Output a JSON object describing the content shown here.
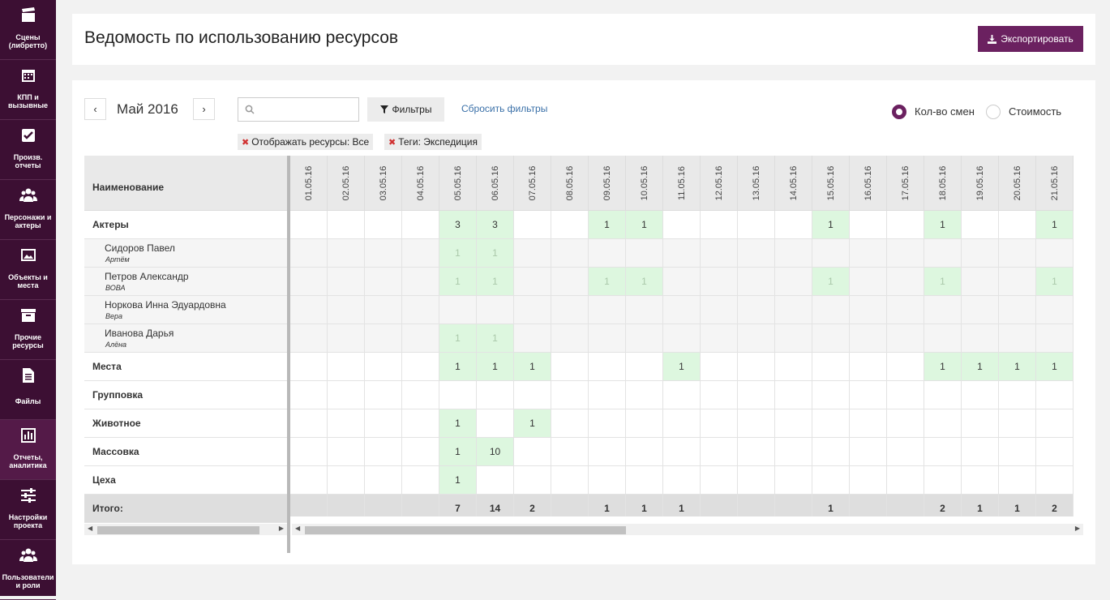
{
  "sidebar": {
    "items": [
      {
        "label": "Сцены (либретто)",
        "icon": "clapperboard-icon"
      },
      {
        "label": "КПП и вызывные",
        "icon": "calendar-icon"
      },
      {
        "label": "Произв. отчеты",
        "icon": "checkbox-icon"
      },
      {
        "label": "Персонажи и актеры",
        "icon": "people-icon"
      },
      {
        "label": "Объекты и места",
        "icon": "image-icon"
      },
      {
        "label": "Прочие ресурсы",
        "icon": "archive-icon"
      },
      {
        "label": "Файлы",
        "icon": "file-icon"
      },
      {
        "label": "Отчеты, аналитика",
        "icon": "bar-chart-icon"
      },
      {
        "label": "Настройки проекта",
        "icon": "sliders-icon"
      },
      {
        "label": "Пользователи и роли",
        "icon": "users-icon"
      }
    ]
  },
  "header": {
    "title": "Ведомость по использованию ресурсов",
    "export_label": "Экспортировать"
  },
  "toolbar": {
    "prev": "‹",
    "next": "›",
    "month": "Май 2016",
    "search_placeholder": "",
    "filters_label": "Фильтры",
    "reset_label": "Сбросить фильтры",
    "tags": [
      "Отображать ресурсы: Все",
      "Теги: Экспедиция"
    ],
    "radio_shifts": "Кол-во смен",
    "radio_cost": "Стоимость",
    "selected": "Кол-во смен"
  },
  "table": {
    "name_header": "Наименование",
    "dates": [
      "01.05.16",
      "02.05.16",
      "03.05.16",
      "04.05.16",
      "05.05.16",
      "06.05.16",
      "07.05.16",
      "08.05.16",
      "09.05.16",
      "10.05.16",
      "11.05.16",
      "12.05.16",
      "13.05.16",
      "14.05.16",
      "15.05.16",
      "16.05.16",
      "17.05.16",
      "18.05.16",
      "19.05.16",
      "20.05.16",
      "21.05.16"
    ],
    "rows": [
      {
        "type": "group",
        "name": "Актеры",
        "values": {
          "4": "3",
          "5": "3",
          "8": "1",
          "9": "1",
          "14": "1",
          "17": "1",
          "20": "1"
        }
      },
      {
        "type": "child",
        "name": "Сидоров Павел",
        "role": "Артём",
        "values": {
          "4": "1",
          "5": "1"
        }
      },
      {
        "type": "child",
        "name": "Петров Александр",
        "role": "ВОВА",
        "values": {
          "4": "1",
          "5": "1",
          "8": "1",
          "9": "1",
          "14": "1",
          "17": "1",
          "20": "1"
        }
      },
      {
        "type": "child",
        "name": "Норкова Инна Эдуардовна",
        "role": "Вера",
        "values": {}
      },
      {
        "type": "child",
        "name": "Иванова Дарья",
        "role": "Алёна",
        "values": {
          "4": "1",
          "5": "1"
        }
      },
      {
        "type": "group",
        "name": "Места",
        "values": {
          "4": "1",
          "5": "1",
          "6": "1",
          "10": "1",
          "17": "1",
          "18": "1",
          "19": "1",
          "20": "1"
        }
      },
      {
        "type": "group",
        "name": "Групповка",
        "values": {}
      },
      {
        "type": "group",
        "name": "Животное",
        "values": {
          "4": "1",
          "6": "1"
        }
      },
      {
        "type": "group",
        "name": "Массовка",
        "values": {
          "4": "1",
          "5": "10"
        }
      },
      {
        "type": "group",
        "name": "Цеха",
        "values": {
          "4": "1"
        }
      }
    ],
    "total": {
      "name": "Итого:",
      "values": {
        "4": "7",
        "5": "14",
        "6": "2",
        "8": "1",
        "9": "1",
        "10": "1",
        "14": "1",
        "17": "2",
        "18": "1",
        "19": "1",
        "20": "2"
      }
    }
  },
  "colors": {
    "accent": "#6b2160",
    "sidebar": "#3c0f33",
    "highlight": "#ddf7df"
  }
}
